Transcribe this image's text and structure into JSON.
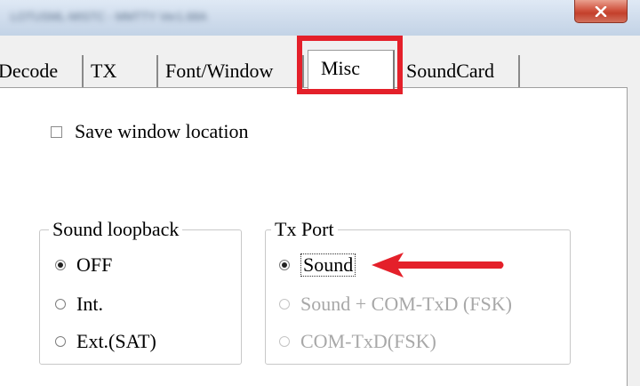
{
  "window": {
    "title": "LOTUSML-MISTC - MMTTY Ver1.68A",
    "close_glyph": "x"
  },
  "tabs": [
    {
      "label": "Decode"
    },
    {
      "label": "TX"
    },
    {
      "label": "Font/Window"
    },
    {
      "label": "Misc",
      "active": true
    },
    {
      "label": "SoundCard"
    }
  ],
  "misc": {
    "save_window_location": {
      "label": "Save window location",
      "checked": false
    },
    "sound_loopback": {
      "title": "Sound loopback",
      "options": [
        {
          "label": "OFF",
          "checked": true
        },
        {
          "label": "Int.",
          "checked": false
        },
        {
          "label": "Ext.(SAT)",
          "checked": false
        }
      ]
    },
    "tx_port": {
      "title": "Tx Port",
      "options": [
        {
          "label": "Sound",
          "checked": true,
          "enabled": true
        },
        {
          "label": "Sound + COM-TxD (FSK)",
          "checked": false,
          "enabled": false
        },
        {
          "label": "COM-TxD(FSK)",
          "checked": false,
          "enabled": false
        }
      ]
    }
  },
  "annotations": {
    "highlight_color": "#e4202a",
    "arrow_color": "#e4202a"
  }
}
